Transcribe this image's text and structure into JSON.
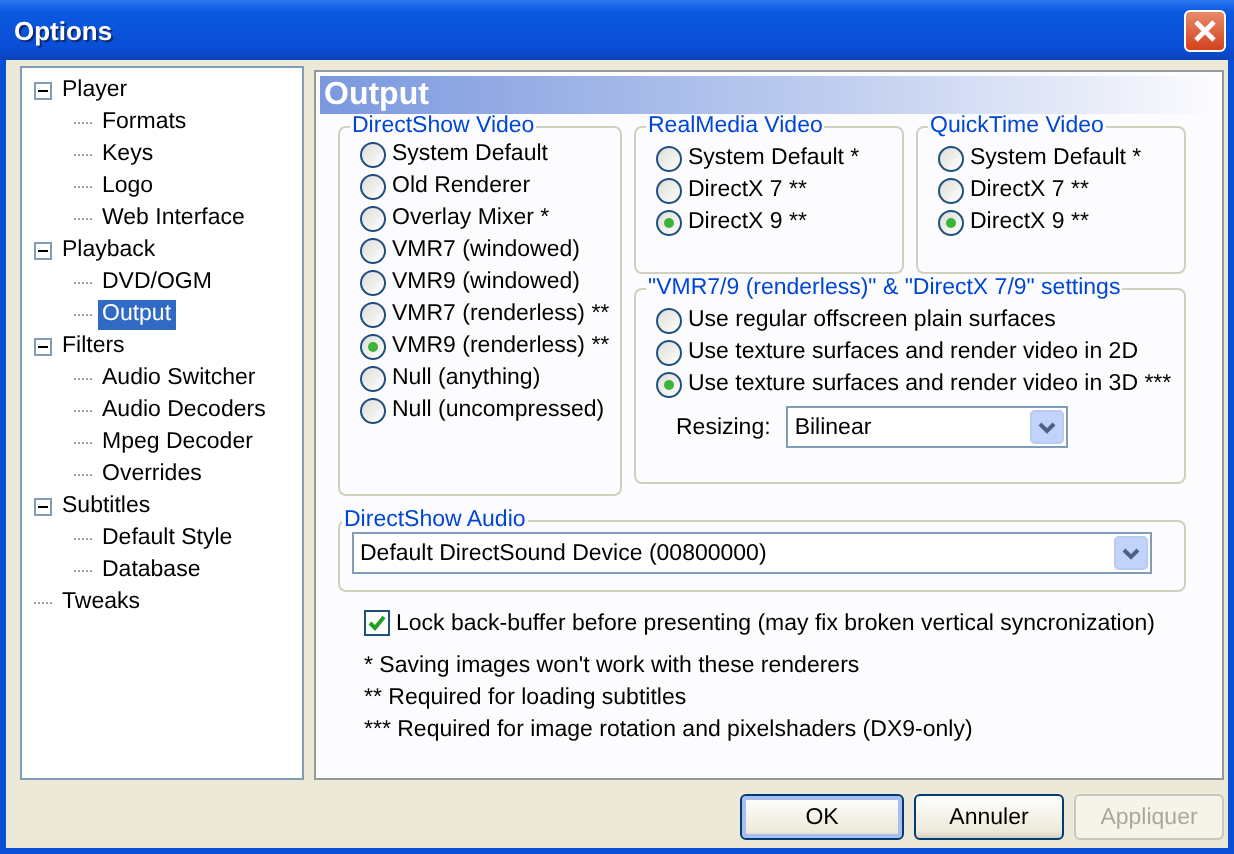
{
  "window": {
    "title": "Options"
  },
  "tree": [
    {
      "label": "Player",
      "expanded": true,
      "selected": false,
      "children": [
        {
          "label": "Formats",
          "selected": false
        },
        {
          "label": "Keys",
          "selected": false
        },
        {
          "label": "Logo",
          "selected": false
        },
        {
          "label": "Web Interface",
          "selected": false
        }
      ]
    },
    {
      "label": "Playback",
      "expanded": true,
      "selected": false,
      "children": [
        {
          "label": "DVD/OGM",
          "selected": false
        },
        {
          "label": "Output",
          "selected": true
        }
      ]
    },
    {
      "label": "Filters",
      "expanded": true,
      "selected": false,
      "children": [
        {
          "label": "Audio Switcher",
          "selected": false
        },
        {
          "label": "Audio Decoders",
          "selected": false
        },
        {
          "label": "Mpeg Decoder",
          "selected": false
        },
        {
          "label": "Overrides",
          "selected": false
        }
      ]
    },
    {
      "label": "Subtitles",
      "expanded": true,
      "selected": false,
      "children": [
        {
          "label": "Default Style",
          "selected": false
        },
        {
          "label": "Database",
          "selected": false
        }
      ]
    },
    {
      "label": "Tweaks",
      "selected": false
    }
  ],
  "page_title": "Output",
  "directshow_video": {
    "title": "DirectShow Video",
    "options": [
      {
        "label": "System Default",
        "selected": false
      },
      {
        "label": "Old Renderer",
        "selected": false
      },
      {
        "label": "Overlay Mixer *",
        "selected": false
      },
      {
        "label": "VMR7 (windowed)",
        "selected": false
      },
      {
        "label": "VMR9 (windowed)",
        "selected": false
      },
      {
        "label": "VMR7 (renderless) **",
        "selected": false
      },
      {
        "label": "VMR9 (renderless) **",
        "selected": true
      },
      {
        "label": "Null (anything)",
        "selected": false
      },
      {
        "label": "Null (uncompressed)",
        "selected": false
      }
    ]
  },
  "realmedia_video": {
    "title": "RealMedia Video",
    "options": [
      {
        "label": "System Default *",
        "selected": false
      },
      {
        "label": "DirectX 7 **",
        "selected": false
      },
      {
        "label": "DirectX 9 **",
        "selected": true
      }
    ]
  },
  "quicktime_video": {
    "title": "QuickTime Video",
    "options": [
      {
        "label": "System Default *",
        "selected": false
      },
      {
        "label": "DirectX 7 **",
        "selected": false
      },
      {
        "label": "DirectX 9 **",
        "selected": true
      }
    ]
  },
  "renderless_settings": {
    "title": "\"VMR7/9 (renderless)\" & \"DirectX 7/9\" settings",
    "options": [
      {
        "label": "Use regular offscreen plain surfaces",
        "selected": false
      },
      {
        "label": "Use texture surfaces and render video in 2D",
        "selected": false
      },
      {
        "label": "Use texture surfaces and render video in 3D ***",
        "selected": true
      }
    ],
    "resizing": {
      "label": "Resizing:",
      "value": "Bilinear"
    }
  },
  "directshow_audio": {
    "title": "DirectShow Audio",
    "device": "Default DirectSound Device (00800000)"
  },
  "lock_backbuffer": {
    "label": "Lock back-buffer before presenting (may fix broken vertical syncronization)",
    "checked": true
  },
  "notes": [
    "* Saving images won't work with these renderers",
    "** Required for loading subtitles",
    "*** Required for image rotation and pixelshaders (DX9-only)"
  ],
  "buttons": [
    {
      "label": "OK",
      "default": true,
      "disabled": false
    },
    {
      "label": "Annuler",
      "default": false,
      "disabled": false
    },
    {
      "label": "Appliquer",
      "default": false,
      "disabled": true
    }
  ]
}
